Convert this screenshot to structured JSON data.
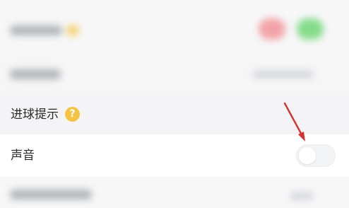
{
  "settings": {
    "goal_alert": {
      "label": "进球提示",
      "help_icon": "question-circle-icon",
      "help_glyph": "?"
    },
    "sound": {
      "label": "声音",
      "toggle_on": false
    }
  },
  "annotation": {
    "arrow_color": "#d3322f"
  },
  "colors": {
    "help_icon": "#f6c342",
    "blurred_red_button": "#f2a3a8",
    "blurred_green_button": "#86dc8a"
  }
}
